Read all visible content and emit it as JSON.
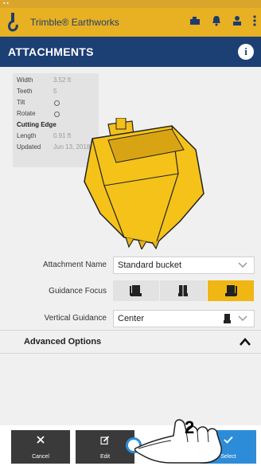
{
  "app": {
    "name": "Trimble® Earthworks"
  },
  "page": {
    "title": "ATTACHMENTS"
  },
  "specs": {
    "width_label": "Width",
    "width_value": "3.52 ft",
    "teeth_label": "Teeth",
    "teeth_value": "5",
    "tilt_label": "Tilt",
    "rotate_label": "Rotate",
    "cutting_edge_label": "Cutting Edge",
    "length_label": "Length",
    "length_value": "0.91 ft",
    "updated_label": "Updated",
    "updated_value": "Jun 13, 2018"
  },
  "form": {
    "attachment_name_label": "Attachment Name",
    "attachment_name_value": "Standard bucket",
    "guidance_focus_label": "Guidance Focus",
    "guidance_focus_options": [
      "left",
      "center",
      "right"
    ],
    "guidance_focus_selected": "right",
    "vertical_guidance_label": "Vertical Guidance",
    "vertical_guidance_value": "Center"
  },
  "advanced": {
    "label": "Advanced Options"
  },
  "footer": {
    "cancel_label": "Cancel",
    "edit_label": "Edit",
    "select_label": "Select"
  },
  "annotation": {
    "step": "2"
  },
  "colors": {
    "appbar": "#e8b123",
    "titlebar": "#1c3f74",
    "accent": "#f0b614",
    "select_button": "#2d8cd8"
  }
}
